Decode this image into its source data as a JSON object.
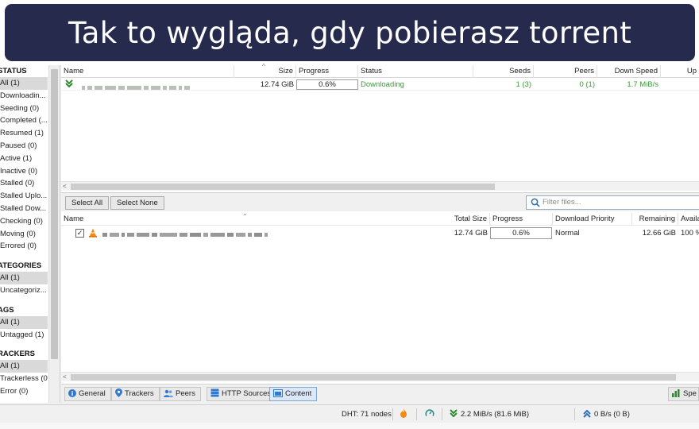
{
  "banner": {
    "text": "Tak to wygląda, gdy pobierasz torrent"
  },
  "sidebar": {
    "status_header": "STATUS",
    "status_items": [
      "All (1)",
      "Downloadin...",
      "Seeding (0)",
      "Completed (...",
      "Resumed (1)",
      "Paused (0)",
      "Active (1)",
      "Inactive (0)",
      "Stalled (0)",
      "Stalled Uplo...",
      "Stalled Dow...",
      "Checking (0)",
      "Moving (0)",
      "Errored (0)"
    ],
    "categories_header": "ATEGORIES",
    "categories_items": [
      "All (1)",
      "Uncategoriz..."
    ],
    "tags_header": "AGS",
    "tags_items": [
      "All (1)",
      "Untagged (1)"
    ],
    "trackers_header": "RACKERS",
    "trackers_items": [
      "All (1)",
      "Trackerless (0)",
      "Error (0)"
    ]
  },
  "torrent_table": {
    "headers": {
      "name": "Name",
      "size": "Size",
      "progress": "Progress",
      "status": "Status",
      "seeds": "Seeds",
      "peers": "Peers",
      "down_speed": "Down Speed",
      "up_speed": "Up"
    },
    "row": {
      "size": "12.74 GiB",
      "progress": "0.6%",
      "status": "Downloading",
      "seeds": "1 (3)",
      "peers": "0 (1)",
      "down_speed": "1.7 MiB/s"
    }
  },
  "content_toolbar": {
    "select_all": "Select All",
    "select_none": "Select None",
    "filter_placeholder": "Filter files..."
  },
  "content_table": {
    "headers": {
      "name": "Name",
      "total_size": "Total Size",
      "progress": "Progress",
      "priority": "Download Priority",
      "remaining": "Remaining",
      "availability": "Availa"
    },
    "row": {
      "total_size": "12.74 GiB",
      "progress": "0.6%",
      "priority": "Normal",
      "remaining": "12.66 GiB",
      "availability": "100 %",
      "checked": "✓"
    }
  },
  "tabs": [
    "General",
    "Trackers",
    "Peers",
    "HTTP Sources",
    "Content"
  ],
  "speed_button": "Spe",
  "statusbar": {
    "dht": "DHT: 71 nodes",
    "download": "2.2 MiB/s (81.6 MiB)",
    "upload": "0 B/s (0 B)"
  },
  "colors": {
    "banner_bg": "#262a4d",
    "downloading_green": "#3a9a3a",
    "active_tab": "#dbe8f7"
  }
}
